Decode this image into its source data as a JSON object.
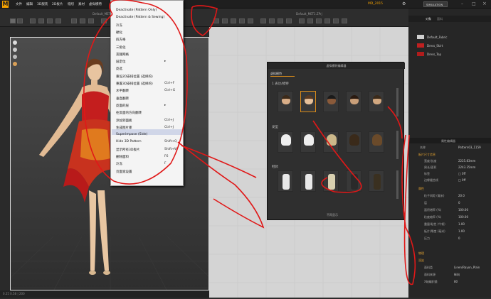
{
  "app": {
    "logo": "M"
  },
  "menubar": {
    "items": [
      "文件",
      "编辑",
      "3D服装",
      "2D板片",
      "缝纫",
      "素材",
      "虚拟模特"
    ],
    "user": "MD_2015",
    "sim_button": "SIMULATION"
  },
  "views": {
    "left_title": "Default_MET",
    "right_title": "Default_MET1.ZPrj"
  },
  "context_menu": {
    "items": [
      {
        "label": "Deactivate (Pattern Only)",
        "key": ""
      },
      {
        "label": "Deactivate (Pattern & Sewing)",
        "key": ""
      },
      {
        "label": "冷冻",
        "key": ""
      },
      {
        "label": "硬化",
        "key": ""
      },
      {
        "label": "四方格",
        "key": ""
      },
      {
        "label": "三角化",
        "key": ""
      },
      {
        "label": "克隆网格",
        "key": ""
      },
      {
        "label": "层定位",
        "key": "▸"
      },
      {
        "label": "反选",
        "key": ""
      },
      {
        "label": "重设2D安排位置 (选择的)",
        "key": ""
      },
      {
        "label": "重置3D安排位置 (选择的)",
        "key": "Ctrl+F"
      },
      {
        "label": "水平翻转",
        "key": "Ctrl+G"
      },
      {
        "label": "垂直翻转",
        "key": ""
      },
      {
        "label": "反面的层",
        "key": "▸"
      },
      {
        "label": "往反面的方向翻转",
        "key": ""
      },
      {
        "label": "添加到面板",
        "key": "Ctrl+J"
      },
      {
        "label": "生成图片库",
        "key": "Ctrl+J"
      },
      {
        "label": "Superimpose (Side)",
        "key": ""
      },
      {
        "label": "Hide 3D Pattern",
        "key": "Shift+Q"
      },
      {
        "label": "显示所有3D板片",
        "key": "Shift+W"
      },
      {
        "label": "删除面料",
        "key": "F6"
      },
      {
        "label": "冷冻",
        "key": "F"
      },
      {
        "label": "页面宽设置",
        "key": ""
      }
    ]
  },
  "dialog": {
    "title": "虚拟模特编辑器",
    "tab": "虚拟模特",
    "sections": [
      "1 表达/模特",
      "发型",
      "鞋款"
    ],
    "footer": "不再显示"
  },
  "right_panel": {
    "tabs": [
      "对象",
      "面料"
    ],
    "fabrics": [
      {
        "name": "Default_Fabric",
        "color": "#cfcfcf"
      },
      {
        "name": "Dress_Skirt",
        "color": "#c02020"
      },
      {
        "name": "Dress_Top",
        "color": "#b01c1c"
      }
    ],
    "prop_header": "属性编辑器",
    "name_label": "名称",
    "name_value": "Pattern03_1159",
    "sections": [
      "板片尺寸信息",
      "属性",
      "物理",
      "渲染"
    ],
    "size_rows": [
      {
        "label": "宽度/长度",
        "value": "2225.83mm"
      },
      {
        "label": "周长/面积",
        "value": "2243.35mm"
      },
      {
        "label": "标签",
        "value": "□ 0ff"
      },
      {
        "label": "边缘缝合线",
        "value": "□ 0ff"
      }
    ],
    "prop_rows": [
      {
        "label": "粒子间距 (毫米)",
        "value": "20.0"
      },
      {
        "label": "层",
        "value": "0"
      },
      {
        "label": "面积增率 (%)",
        "value": "100.00"
      },
      {
        "label": "粒度缩率 (%)",
        "value": "100.00"
      },
      {
        "label": "重量/粘性 (牛顿)",
        "value": "1.00"
      },
      {
        "label": "板片/厚度 (毫米)",
        "value": "1.00"
      },
      {
        "label": "压力",
        "value": "0"
      }
    ],
    "render_rows": [
      {
        "label": "面料类",
        "value": "Linen/Rayon_Plain"
      },
      {
        "label": "面料来源",
        "value": "纵向"
      },
      {
        "label": "X轴编织量",
        "value": "80"
      }
    ]
  },
  "status": {
    "text": "0.25 0.58 | 200"
  }
}
